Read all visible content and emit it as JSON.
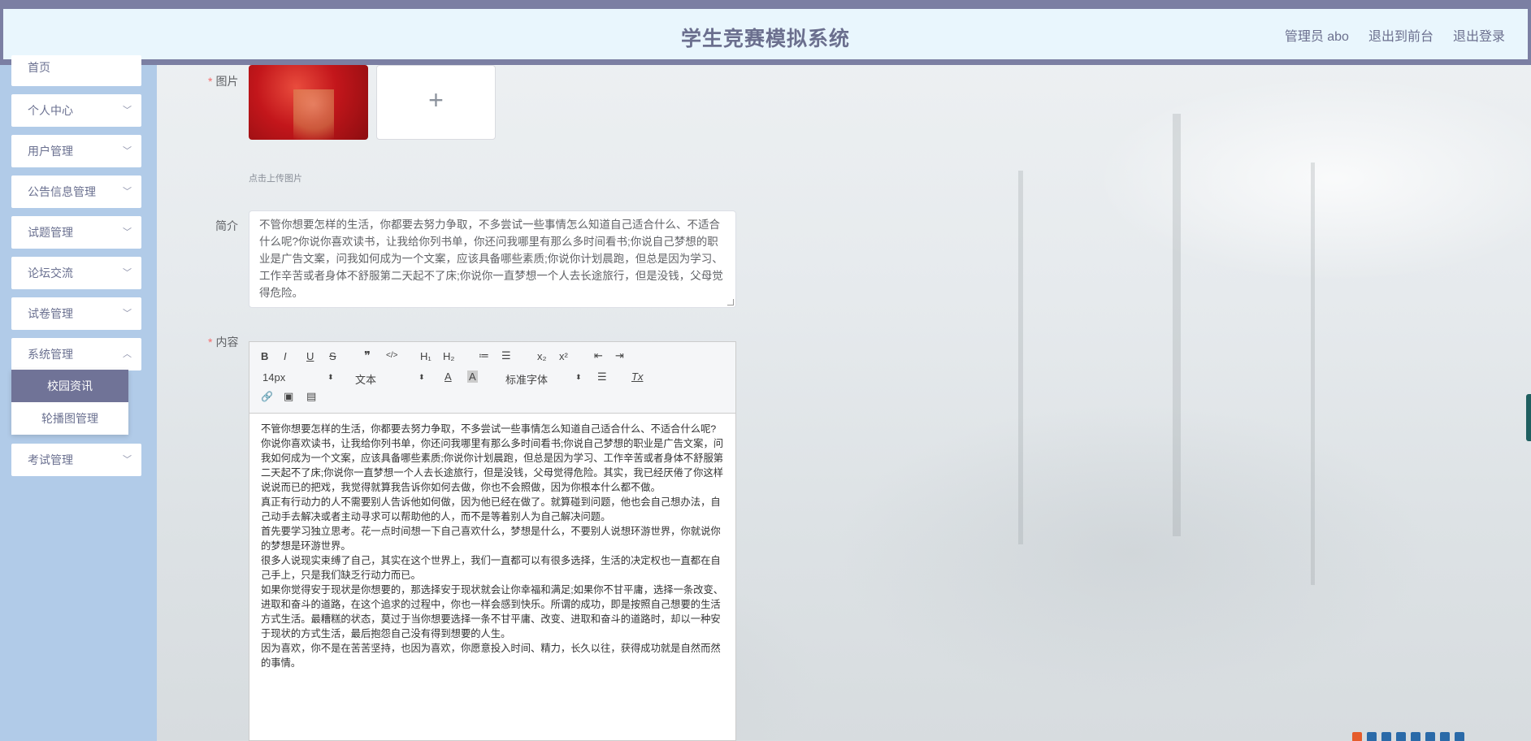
{
  "header": {
    "title": "学生竞赛模拟系统",
    "user_label": "管理员 abo",
    "back_front": "退出到前台",
    "logout": "退出登录"
  },
  "sidebar": {
    "items": [
      {
        "label": "首页"
      },
      {
        "label": "个人中心"
      },
      {
        "label": "用户管理"
      },
      {
        "label": "公告信息管理"
      },
      {
        "label": "试题管理"
      },
      {
        "label": "论坛交流"
      },
      {
        "label": "试卷管理"
      },
      {
        "label": "系统管理"
      },
      {
        "label": "考试管理"
      }
    ],
    "submenu": [
      {
        "label": "校园资讯",
        "active": true
      },
      {
        "label": "轮播图管理",
        "active": false
      }
    ]
  },
  "form": {
    "image_label": "图片",
    "upload_plus": "+",
    "upload_hint": "点击上传图片",
    "intro_label": "简介",
    "intro_text": "不管你想要怎样的生活，你都要去努力争取，不多尝试一些事情怎么知道自己适合什么、不适合什么呢?你说你喜欢读书，让我给你列书单，你还问我哪里有那么多时间看书;你说自己梦想的职业是广告文案，问我如何成为一个文案，应该具备哪些素质;你说你计划晨跑，但总是因为学习、工作辛苦或者身体不舒服第二天起不了床;你说你一直梦想一个人去长途旅行，但是没钱，父母觉得危险。",
    "content_label": "内容"
  },
  "editor": {
    "font_size": "14px",
    "block_type": "文本",
    "font_family": "标准字体",
    "buttons": {
      "bold": "B",
      "italic": "I",
      "underline": "U",
      "strike": "S",
      "quote": "❞",
      "code": "</>",
      "h1": "H₁",
      "h2": "H₂",
      "ol": "≔",
      "ul": "☰",
      "sub": "x₂",
      "sup": "x²",
      "outdent": "⇤",
      "indent": "⇥",
      "color": "A",
      "background": "A",
      "align": "☰",
      "clean": "Tx",
      "link": "🔗",
      "image": "▣",
      "video": "▤"
    },
    "content": [
      "不管你想要怎样的生活，你都要去努力争取，不多尝试一些事情怎么知道自己适合什么、不适合什么呢?",
      "你说你喜欢读书，让我给你列书单，你还问我哪里有那么多时间看书;你说自己梦想的职业是广告文案，问我如何成为一个文案，应该具备哪些素质;你说你计划晨跑，但总是因为学习、工作辛苦或者身体不舒服第二天起不了床;你说你一直梦想一个人去长途旅行，但是没钱，父母觉得危险。其实，我已经厌倦了你这样说说而已的把戏，我觉得就算我告诉你如何去做，你也不会照做，因为你根本什么都不做。",
      "真正有行动力的人不需要别人告诉他如何做，因为他已经在做了。就算碰到问题，他也会自己想办法，自己动手去解决或者主动寻求可以帮助他的人，而不是等着别人为自己解决问题。",
      "首先要学习独立思考。花一点时间想一下自己喜欢什么，梦想是什么，不要别人说想环游世界，你就说你的梦想是环游世界。",
      "很多人说现实束缚了自己，其实在这个世界上，我们一直都可以有很多选择，生活的决定权也一直都在自己手上，只是我们缺乏行动力而已。",
      "如果你觉得安于现状是你想要的，那选择安于现状就会让你幸福和满足;如果你不甘平庸，选择一条改变、进取和奋斗的道路，在这个追求的过程中，你也一样会感到快乐。所谓的成功，即是按照自己想要的生活方式生活。最糟糕的状态，莫过于当你想要选择一条不甘平庸、改变、进取和奋斗的道路时，却以一种安于现状的方式生活，最后抱怨自己没有得到想要的人生。",
      "因为喜欢，你不是在苦苦坚持，也因为喜欢，你愿意投入时间、精力，长久以往，获得成功就是自然而然的事情。"
    ]
  }
}
